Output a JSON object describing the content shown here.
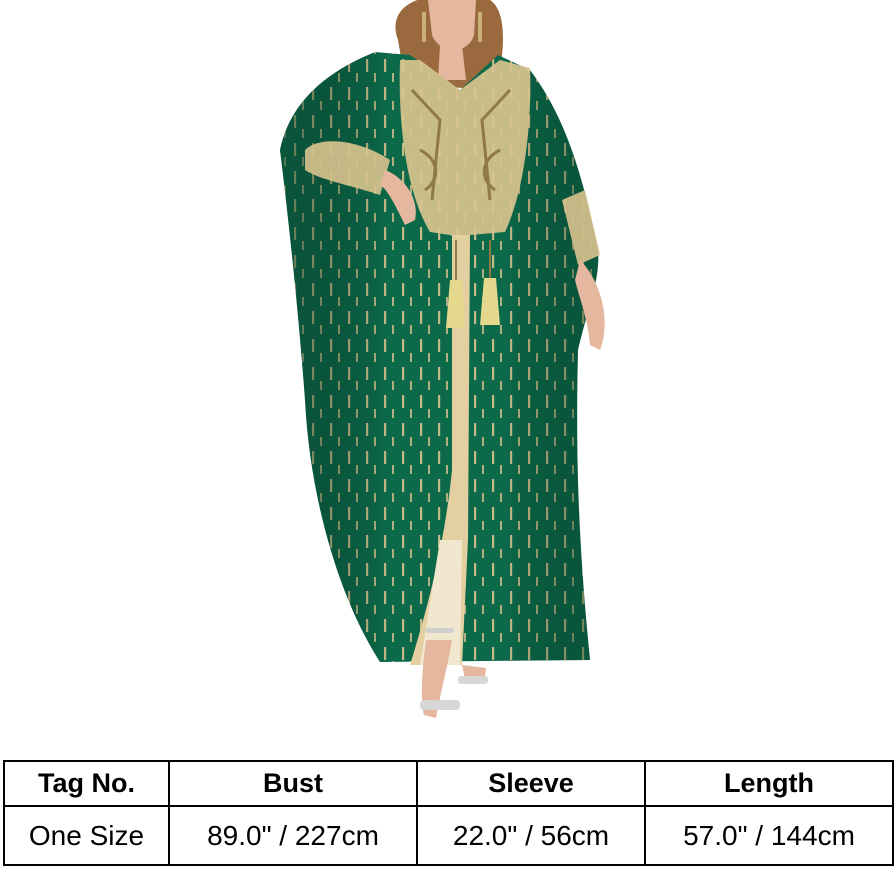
{
  "product_image": {
    "alt_icon": "green-gold-abaya-kaftan-photo",
    "colors": {
      "dress": "#0c6a4a",
      "gold": "#d9c38e",
      "skin": "#e4b79e",
      "hair": "#9a6a3e"
    }
  },
  "size_table": {
    "headers": [
      "Tag No.",
      "Bust",
      "Sleeve",
      "Length"
    ],
    "rows": [
      [
        "One Size",
        "89.0\" / 227cm",
        "22.0\" / 56cm",
        "57.0\" / 144cm"
      ]
    ]
  }
}
